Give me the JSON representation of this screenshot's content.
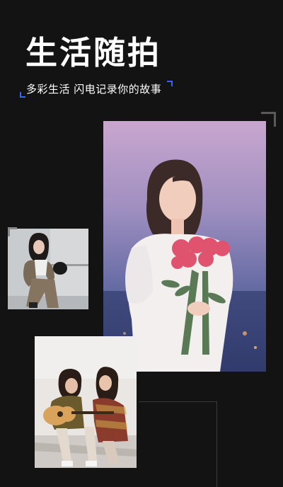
{
  "header": {
    "title": "生活随拍",
    "subtitle": "多彩生活 闪电记录你的故事"
  },
  "photos": {
    "main": "girl-with-roses-photo",
    "left": "woman-sitting-photo",
    "bottom": "friends-with-guitar-photo"
  },
  "colors": {
    "background": "#131313",
    "accent": "#3a63ff",
    "text": "#ffffff"
  }
}
